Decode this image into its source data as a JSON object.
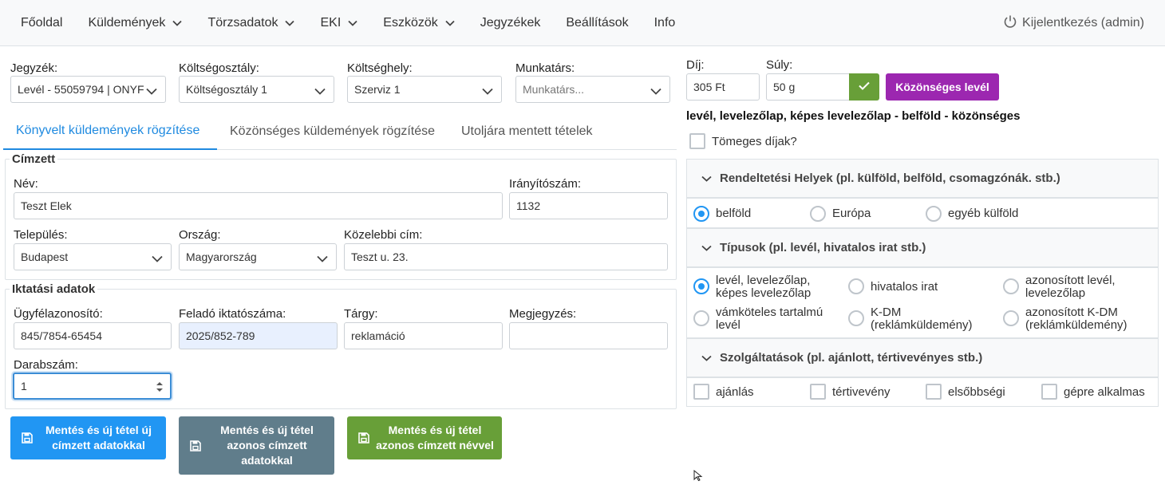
{
  "nav": {
    "items": [
      {
        "label": "Főoldal",
        "dropdown": false
      },
      {
        "label": "Küldemények",
        "dropdown": true
      },
      {
        "label": "Törzsadatok",
        "dropdown": true
      },
      {
        "label": "EKI",
        "dropdown": true
      },
      {
        "label": "Eszközök",
        "dropdown": true
      },
      {
        "label": "Jegyzékek",
        "dropdown": false
      },
      {
        "label": "Beállítások",
        "dropdown": false
      },
      {
        "label": "Info",
        "dropdown": false
      }
    ],
    "logout": "Kijelentkezés (admin)"
  },
  "top_filters": {
    "jegyzek_label": "Jegyzék:",
    "jegyzek_value": "Levél - 55059794 | ONYF",
    "koltsegosztaly_label": "Költségosztály:",
    "koltsegosztaly_value": "Költségosztály 1",
    "koltseghely_label": "Költséghely:",
    "koltseghely_value": "Szerviz 1",
    "munkatars_label": "Munkatárs:",
    "munkatars_placeholder": "Munkatárs..."
  },
  "tabs": [
    {
      "label": "Könyvelt küldemények rögzítése",
      "active": true
    },
    {
      "label": "Közönséges küldemények rögzítése",
      "active": false
    },
    {
      "label": "Utoljára mentett tételek",
      "active": false
    }
  ],
  "cimzett": {
    "legend": "Címzett",
    "nev_label": "Név:",
    "nev_value": "Teszt Elek",
    "irsz_label": "Irányítószám:",
    "irsz_value": "1132",
    "telepules_label": "Település:",
    "telepules_value": "Budapest",
    "orszag_label": "Ország:",
    "orszag_value": "Magyarország",
    "cim_label": "Közelebbi cím:",
    "cim_value": "Teszt u. 23."
  },
  "iktatas": {
    "legend": "Iktatási adatok",
    "ugyfel_label": "Ügyfélazonosító:",
    "ugyfel_value": "845/7854-65454",
    "felado_label": "Feladó iktatószáma:",
    "felado_value": "2025/852-789",
    "targy_label": "Tárgy:",
    "targy_value": "reklamáció",
    "megjegyzes_label": "Megjegyzés:",
    "megjegyzes_value": "",
    "darab_label": "Darabszám:",
    "darab_value": "1"
  },
  "buttons": {
    "save_new_recipient": "Mentés és új tétel új címzett adatokkal",
    "save_same_recipient": "Mentés és új tétel azonos címzett adatokkal",
    "save_same_name": "Mentés és új tétel azonos címzett névvel"
  },
  "pricing": {
    "dij_label": "Díj:",
    "dij_value": "305 Ft",
    "suly_label": "Súly:",
    "suly_value": "50 g",
    "type_button": "Közönséges levél",
    "description": "levél, levelezőlap, képes levelezőlap - belföld - közönséges",
    "bulk_label": "Tömeges díjak?"
  },
  "destinations": {
    "header": "Rendeltetési Helyek (pl. külföld, belföld, csomagzónák. stb.)",
    "options": [
      {
        "label": "belföld",
        "selected": true
      },
      {
        "label": "Európa",
        "selected": false
      },
      {
        "label": "egyéb külföld",
        "selected": false
      }
    ]
  },
  "types": {
    "header": "Típusok (pl. levél, hivatalos irat stb.)",
    "options": [
      {
        "line1": "levél, levelezőlap,",
        "line2": "képes levelezőlap",
        "selected": true
      },
      {
        "line1": "hivatalos irat",
        "line2": "",
        "selected": false
      },
      {
        "line1": "azonosított levél,",
        "line2": "levelezőlap",
        "selected": false
      },
      {
        "line1": "vámköteles tartalmú",
        "line2": "levél",
        "selected": false
      },
      {
        "line1": "K-DM",
        "line2": "(reklámküldemény)",
        "selected": false
      },
      {
        "line1": "azonosított K-DM",
        "line2": "(reklámküldemény)",
        "selected": false
      }
    ]
  },
  "services": {
    "header": "Szolgáltatások (pl. ajánlott, tértivevényes stb.)",
    "options": [
      {
        "label": "ajánlás",
        "checked": false
      },
      {
        "label": "tértivevény",
        "checked": false
      },
      {
        "label": "elsőbbségi",
        "checked": false
      },
      {
        "label": "gépre alkalmas",
        "checked": false
      }
    ]
  },
  "colors": {
    "primary": "#2196f3",
    "grey_button": "#607d8b",
    "green_button": "#689f38",
    "purple_button": "#9c27b0"
  }
}
